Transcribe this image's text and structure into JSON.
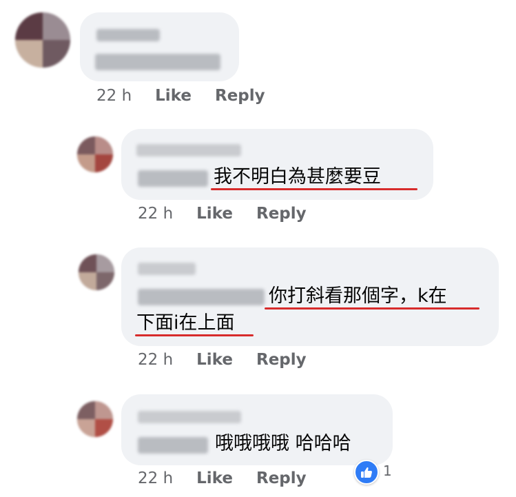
{
  "comments": [
    {
      "author": "",
      "line1_tag": "",
      "text": "",
      "time": "22 h",
      "like_label": "Like",
      "reply_label": "Reply"
    },
    {
      "author": "",
      "mention": "",
      "text": "我不明白為甚麼要豆",
      "time": "22 h",
      "like_label": "Like",
      "reply_label": "Reply"
    },
    {
      "author": "",
      "mention": "",
      "text_line1": "你打斜看那個字，k在",
      "text_line2": "下面i在上面",
      "time": "22 h",
      "like_label": "Like",
      "reply_label": "Reply"
    },
    {
      "author": "",
      "mention": "",
      "text": "哦哦哦哦 哈哈哈",
      "time": "22 h",
      "like_label": "Like",
      "reply_label": "Reply",
      "reaction_count": "1",
      "reaction_icon": "thumbs-up-icon"
    }
  ],
  "colors": {
    "bubble": "#f0f2f5",
    "meta": "#65676b",
    "underline": "#d72b2b",
    "like_blue": "#2f7cf6"
  }
}
